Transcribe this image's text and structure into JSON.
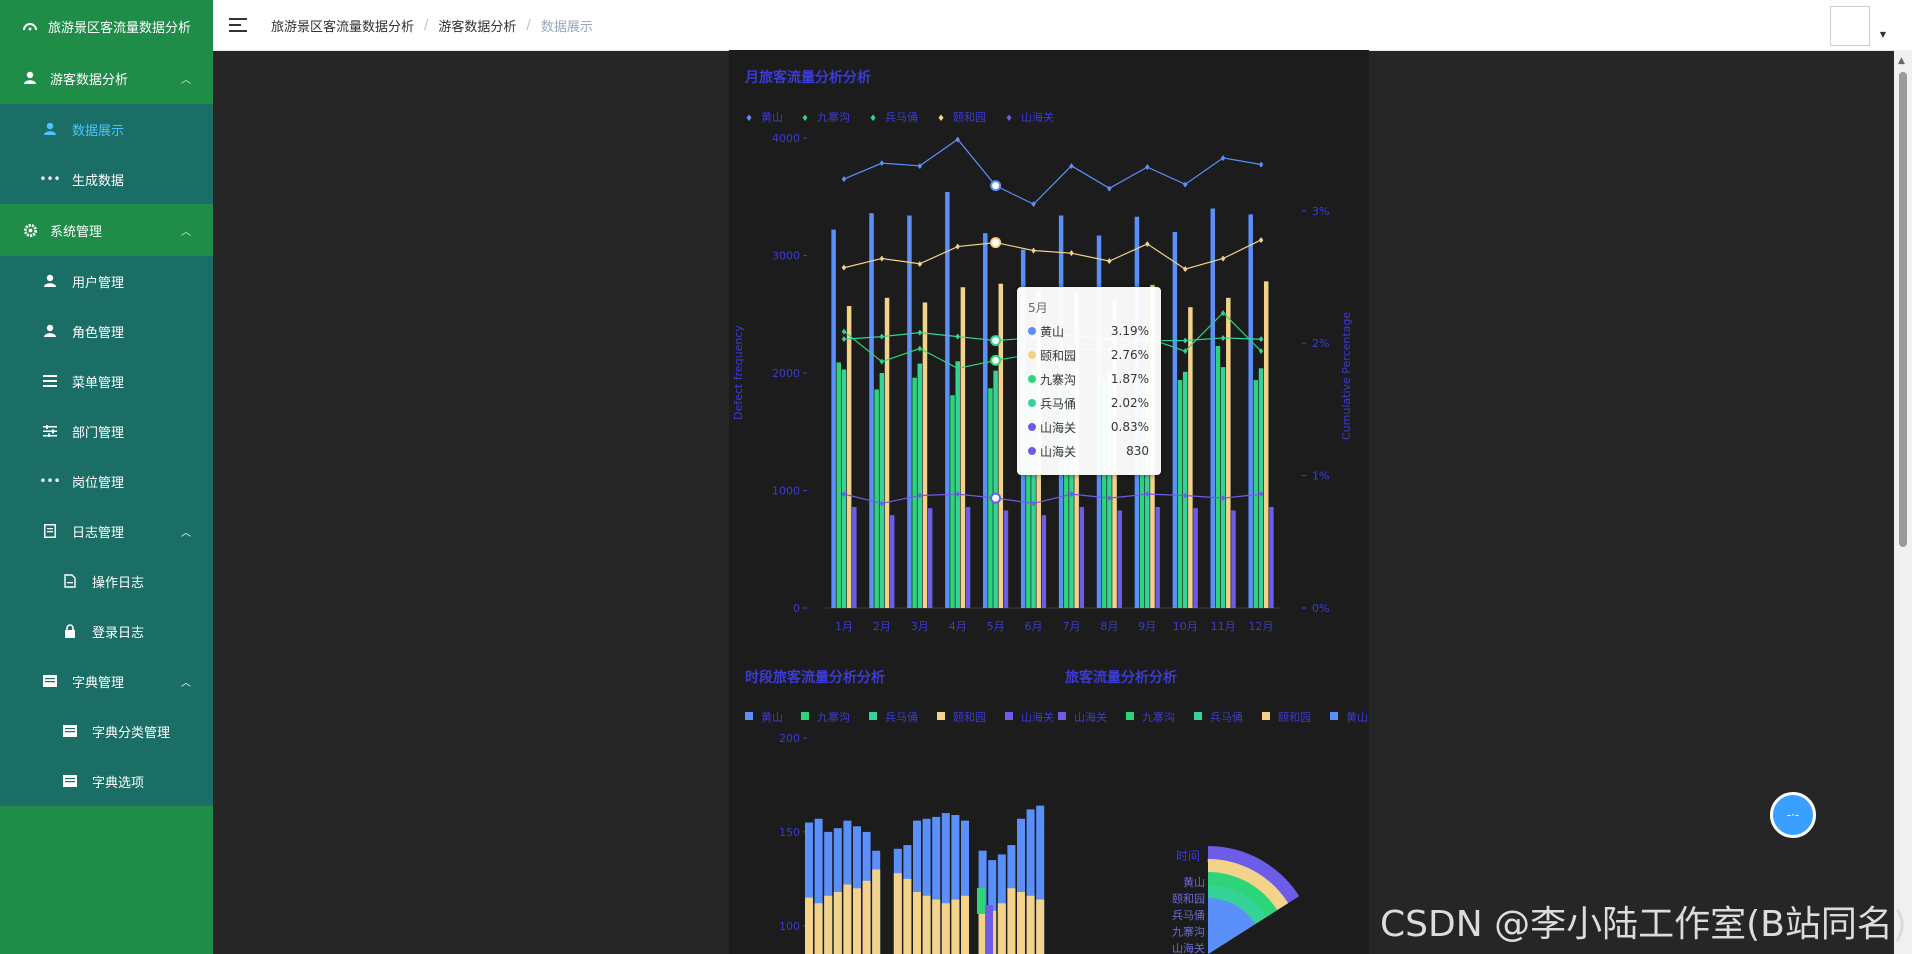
{
  "app": {
    "title": "旅游景区客流量数据分析"
  },
  "sidebar": {
    "groups": [
      {
        "label": "游客数据分析",
        "items": [
          "数据展示",
          "生成数据"
        ]
      },
      {
        "label": "系统管理",
        "items": [
          "用户管理",
          "角色管理",
          "菜单管理",
          "部门管理",
          "岗位管理"
        ]
      }
    ],
    "log_group": {
      "label": "日志管理",
      "items": [
        "操作日志",
        "登录日志"
      ]
    },
    "dict_group": {
      "label": "字典管理",
      "items": [
        "字典分类管理",
        "字典选项"
      ]
    }
  },
  "breadcrumb": [
    "旅游景区客流量数据分析",
    "游客数据分析",
    "数据展示"
  ],
  "watermark": "CSDN @李小陆工作室(B站同名)",
  "colors": {
    "huangshan": "#5b8ff9",
    "jiuzhaigou": "#2ed47a",
    "bingmayong": "#36d399",
    "yiheyuan": "#f3d38a",
    "shanhaiguan": "#6c5ce7",
    "accent": "#3b3bd6"
  },
  "tooltip": {
    "title": "5月",
    "rows": [
      {
        "name": "黄山",
        "value": "3.19%",
        "color": "#5b8ff9"
      },
      {
        "name": "颐和园",
        "value": "2.76%",
        "color": "#f3d38a"
      },
      {
        "name": "九寨沟",
        "value": "1.87%",
        "color": "#2ed47a"
      },
      {
        "name": "兵马俑",
        "value": "2.02%",
        "color": "#36d399"
      },
      {
        "name": "山海关",
        "value": "0.83%",
        "color": "#6c5ce7"
      },
      {
        "name": "山海关",
        "value": "830",
        "color": "#6c5ce7"
      }
    ]
  },
  "chart_data": [
    {
      "type": "bar",
      "title": "月旅客流量分析分析",
      "legend": [
        "黄山",
        "九寨沟",
        "兵马俑",
        "颐和园",
        "山海关"
      ],
      "ylabel": "Defect frequency",
      "y2label": "Cumulative Percentage",
      "yticks": [
        "0",
        "1000",
        "2000",
        "3000",
        "4000"
      ],
      "y2ticks": [
        "0%",
        "1%",
        "2%",
        "3%"
      ],
      "ylim": [
        0,
        4000
      ],
      "categories": [
        "1月",
        "2月",
        "3月",
        "4月",
        "5月",
        "6月",
        "7月",
        "8月",
        "9月",
        "10月",
        "11月",
        "12月"
      ],
      "series": [
        {
          "name": "黄山",
          "values": [
            3220,
            3360,
            3340,
            3540,
            3190,
            3050,
            3340,
            3170,
            3330,
            3200,
            3400,
            3350
          ]
        },
        {
          "name": "九寨沟",
          "values": [
            2090,
            1860,
            1960,
            1810,
            1870,
            1920,
            1960,
            1950,
            2040,
            1940,
            2230,
            1940
          ]
        },
        {
          "name": "兵马俑",
          "values": [
            2030,
            2000,
            2080,
            2100,
            2020,
            2050,
            2060,
            2030,
            2000,
            2010,
            2050,
            2040
          ]
        },
        {
          "name": "颐和园",
          "values": [
            2570,
            2640,
            2600,
            2730,
            2760,
            2700,
            2680,
            2620,
            2750,
            2560,
            2640,
            2780
          ]
        },
        {
          "name": "山海关",
          "values": [
            860,
            790,
            850,
            860,
            830,
            790,
            860,
            830,
            860,
            850,
            830,
            860
          ]
        }
      ],
      "lines": [
        {
          "name": "黄山",
          "values": [
            3.24,
            3.36,
            3.34,
            3.54,
            3.19,
            3.05,
            3.34,
            3.17,
            3.33,
            3.2,
            3.4,
            3.35
          ]
        },
        {
          "name": "颐和园",
          "values": [
            2.57,
            2.64,
            2.6,
            2.73,
            2.76,
            2.7,
            2.68,
            2.62,
            2.75,
            2.56,
            2.64,
            2.78
          ]
        },
        {
          "name": "九寨沟",
          "values": [
            2.09,
            1.86,
            1.96,
            1.81,
            1.87,
            1.92,
            1.96,
            1.95,
            2.04,
            1.94,
            2.23,
            1.94
          ]
        },
        {
          "name": "兵马俑",
          "values": [
            2.03,
            2.05,
            2.08,
            2.05,
            2.02,
            2.04,
            2.06,
            2.03,
            2.02,
            2.02,
            2.04,
            2.03
          ]
        },
        {
          "name": "山海关",
          "values": [
            0.86,
            0.79,
            0.85,
            0.86,
            0.83,
            0.79,
            0.86,
            0.83,
            0.86,
            0.85,
            0.83,
            0.86
          ]
        }
      ]
    },
    {
      "type": "bar",
      "title": "时段旅客流量分析分析",
      "legend": [
        "黄山",
        "九寨沟",
        "兵马俑",
        "颐和园",
        "山海关"
      ],
      "yticks": [
        "200",
        "150",
        "100"
      ],
      "ylim": [
        100,
        200
      ],
      "series": [
        {
          "name": "黄山",
          "values": [
            155,
            157,
            150,
            152,
            156,
            153,
            150,
            140,
            141,
            143,
            156,
            157,
            158,
            160,
            159,
            156,
            140,
            135,
            138,
            143,
            157,
            162,
            164
          ]
        },
        {
          "name": "颐和园",
          "values": [
            115,
            112,
            116,
            118,
            122,
            120,
            124,
            130,
            128,
            125,
            118,
            116,
            114,
            112,
            114,
            116,
            110,
            108,
            112,
            120,
            118,
            116,
            114
          ]
        }
      ]
    },
    {
      "type": "pie",
      "title": "旅客流量分析分析",
      "legend": [
        "山海关",
        "九寨沟",
        "兵马俑",
        "颐和园",
        "黄山"
      ],
      "axis_title": "时间",
      "axis_zero": "0",
      "categories": [
        "黄山",
        "颐和园",
        "兵马俑",
        "九寨沟",
        "山海关"
      ]
    }
  ]
}
